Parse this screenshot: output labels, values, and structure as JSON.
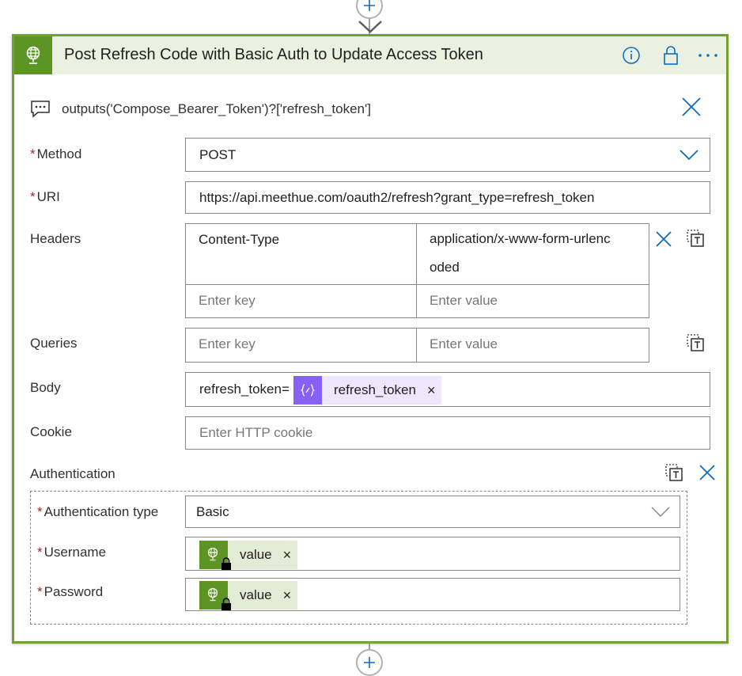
{
  "colors": {
    "brand_green": "#5c9524",
    "header_bg": "#eaf1e1",
    "accent_blue": "#0f6cbd",
    "expression_purple": "#8661f5",
    "token_bg_purple": "#ede7fd",
    "token_bg_green": "#e2ebd6",
    "required_red": "#a4262c"
  },
  "action": {
    "title": "Post Refresh Code with Basic Auth to Update Access Token",
    "icon": "globe-icon",
    "header_buttons": [
      "info-icon",
      "lock-icon",
      "more-icon"
    ]
  },
  "comment": {
    "text": "outputs('Compose_Bearer_Token')?['refresh_token']"
  },
  "fields": {
    "method": {
      "label": "Method",
      "required_mark": "*",
      "value": "POST"
    },
    "uri": {
      "label": "URI",
      "required_mark": "*",
      "value": "https://api.meethue.com/oauth2/refresh?grant_type=refresh_token"
    },
    "headers": {
      "label": "Headers",
      "rows": [
        {
          "key": "Content-Type",
          "value_line1": "application/x-www-form-urlenc",
          "value_line2": "oded"
        }
      ],
      "key_placeholder": "Enter key",
      "value_placeholder": "Enter value"
    },
    "queries": {
      "label": "Queries",
      "key_placeholder": "Enter key",
      "value_placeholder": "Enter value"
    },
    "body": {
      "label": "Body",
      "prefix_text": "refresh_token=",
      "token_label": "refresh_token",
      "token_icon": "expression-icon",
      "remove_glyph": "×"
    },
    "cookie": {
      "label": "Cookie",
      "placeholder": "Enter HTTP cookie"
    },
    "authentication": {
      "label": "Authentication",
      "type": {
        "label": "Authentication type",
        "required_mark": "*",
        "value": "Basic"
      },
      "username": {
        "label": "Username",
        "required_mark": "*",
        "token_label": "value",
        "token_icon": "globe-lock-icon",
        "remove_glyph": "×"
      },
      "password": {
        "label": "Password",
        "required_mark": "*",
        "token_label": "value",
        "token_icon": "globe-lock-icon",
        "remove_glyph": "×"
      }
    }
  }
}
